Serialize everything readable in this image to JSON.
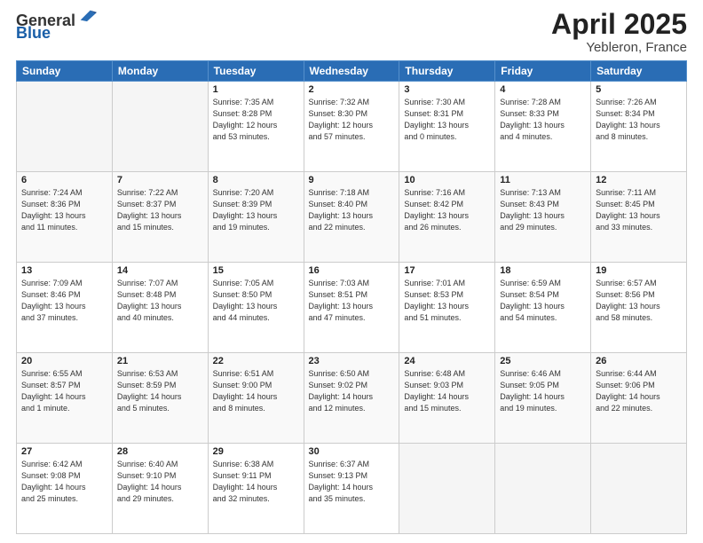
{
  "header": {
    "logo_general": "General",
    "logo_blue": "Blue",
    "title": "April 2025",
    "location": "Yebleron, France"
  },
  "weekdays": [
    "Sunday",
    "Monday",
    "Tuesday",
    "Wednesday",
    "Thursday",
    "Friday",
    "Saturday"
  ],
  "weeks": [
    [
      {
        "day": "",
        "info": ""
      },
      {
        "day": "",
        "info": ""
      },
      {
        "day": "1",
        "info": "Sunrise: 7:35 AM\nSunset: 8:28 PM\nDaylight: 12 hours\nand 53 minutes."
      },
      {
        "day": "2",
        "info": "Sunrise: 7:32 AM\nSunset: 8:30 PM\nDaylight: 12 hours\nand 57 minutes."
      },
      {
        "day": "3",
        "info": "Sunrise: 7:30 AM\nSunset: 8:31 PM\nDaylight: 13 hours\nand 0 minutes."
      },
      {
        "day": "4",
        "info": "Sunrise: 7:28 AM\nSunset: 8:33 PM\nDaylight: 13 hours\nand 4 minutes."
      },
      {
        "day": "5",
        "info": "Sunrise: 7:26 AM\nSunset: 8:34 PM\nDaylight: 13 hours\nand 8 minutes."
      }
    ],
    [
      {
        "day": "6",
        "info": "Sunrise: 7:24 AM\nSunset: 8:36 PM\nDaylight: 13 hours\nand 11 minutes."
      },
      {
        "day": "7",
        "info": "Sunrise: 7:22 AM\nSunset: 8:37 PM\nDaylight: 13 hours\nand 15 minutes."
      },
      {
        "day": "8",
        "info": "Sunrise: 7:20 AM\nSunset: 8:39 PM\nDaylight: 13 hours\nand 19 minutes."
      },
      {
        "day": "9",
        "info": "Sunrise: 7:18 AM\nSunset: 8:40 PM\nDaylight: 13 hours\nand 22 minutes."
      },
      {
        "day": "10",
        "info": "Sunrise: 7:16 AM\nSunset: 8:42 PM\nDaylight: 13 hours\nand 26 minutes."
      },
      {
        "day": "11",
        "info": "Sunrise: 7:13 AM\nSunset: 8:43 PM\nDaylight: 13 hours\nand 29 minutes."
      },
      {
        "day": "12",
        "info": "Sunrise: 7:11 AM\nSunset: 8:45 PM\nDaylight: 13 hours\nand 33 minutes."
      }
    ],
    [
      {
        "day": "13",
        "info": "Sunrise: 7:09 AM\nSunset: 8:46 PM\nDaylight: 13 hours\nand 37 minutes."
      },
      {
        "day": "14",
        "info": "Sunrise: 7:07 AM\nSunset: 8:48 PM\nDaylight: 13 hours\nand 40 minutes."
      },
      {
        "day": "15",
        "info": "Sunrise: 7:05 AM\nSunset: 8:50 PM\nDaylight: 13 hours\nand 44 minutes."
      },
      {
        "day": "16",
        "info": "Sunrise: 7:03 AM\nSunset: 8:51 PM\nDaylight: 13 hours\nand 47 minutes."
      },
      {
        "day": "17",
        "info": "Sunrise: 7:01 AM\nSunset: 8:53 PM\nDaylight: 13 hours\nand 51 minutes."
      },
      {
        "day": "18",
        "info": "Sunrise: 6:59 AM\nSunset: 8:54 PM\nDaylight: 13 hours\nand 54 minutes."
      },
      {
        "day": "19",
        "info": "Sunrise: 6:57 AM\nSunset: 8:56 PM\nDaylight: 13 hours\nand 58 minutes."
      }
    ],
    [
      {
        "day": "20",
        "info": "Sunrise: 6:55 AM\nSunset: 8:57 PM\nDaylight: 14 hours\nand 1 minute."
      },
      {
        "day": "21",
        "info": "Sunrise: 6:53 AM\nSunset: 8:59 PM\nDaylight: 14 hours\nand 5 minutes."
      },
      {
        "day": "22",
        "info": "Sunrise: 6:51 AM\nSunset: 9:00 PM\nDaylight: 14 hours\nand 8 minutes."
      },
      {
        "day": "23",
        "info": "Sunrise: 6:50 AM\nSunset: 9:02 PM\nDaylight: 14 hours\nand 12 minutes."
      },
      {
        "day": "24",
        "info": "Sunrise: 6:48 AM\nSunset: 9:03 PM\nDaylight: 14 hours\nand 15 minutes."
      },
      {
        "day": "25",
        "info": "Sunrise: 6:46 AM\nSunset: 9:05 PM\nDaylight: 14 hours\nand 19 minutes."
      },
      {
        "day": "26",
        "info": "Sunrise: 6:44 AM\nSunset: 9:06 PM\nDaylight: 14 hours\nand 22 minutes."
      }
    ],
    [
      {
        "day": "27",
        "info": "Sunrise: 6:42 AM\nSunset: 9:08 PM\nDaylight: 14 hours\nand 25 minutes."
      },
      {
        "day": "28",
        "info": "Sunrise: 6:40 AM\nSunset: 9:10 PM\nDaylight: 14 hours\nand 29 minutes."
      },
      {
        "day": "29",
        "info": "Sunrise: 6:38 AM\nSunset: 9:11 PM\nDaylight: 14 hours\nand 32 minutes."
      },
      {
        "day": "30",
        "info": "Sunrise: 6:37 AM\nSunset: 9:13 PM\nDaylight: 14 hours\nand 35 minutes."
      },
      {
        "day": "",
        "info": ""
      },
      {
        "day": "",
        "info": ""
      },
      {
        "day": "",
        "info": ""
      }
    ]
  ]
}
